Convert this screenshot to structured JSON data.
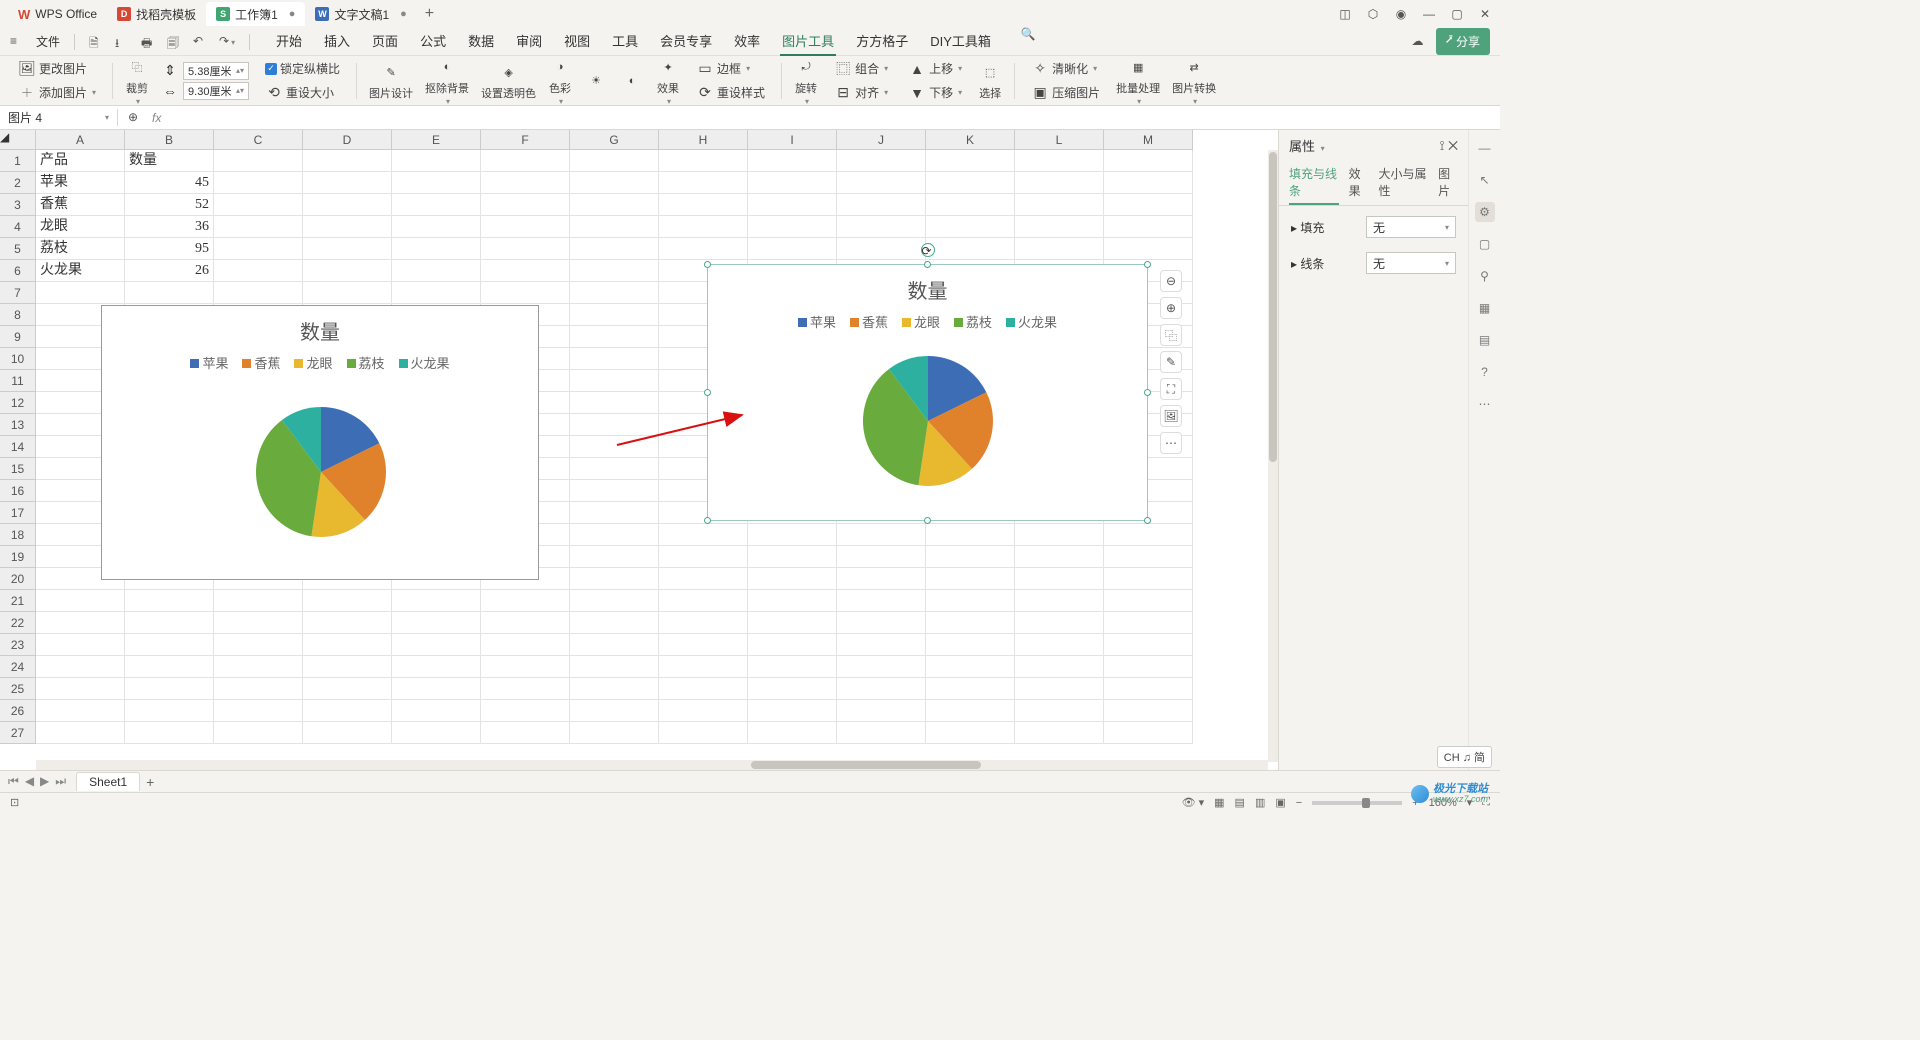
{
  "title_tabs": {
    "app_name": "WPS Office",
    "template_tab": "找稻壳模板",
    "workbook_tab": "工作簿1",
    "doc_tab": "文字文稿1"
  },
  "menu": {
    "file": "文件",
    "tabs": [
      "开始",
      "插入",
      "页面",
      "公式",
      "数据",
      "审阅",
      "视图",
      "工具",
      "会员专享",
      "效率",
      "图片工具",
      "方方格子",
      "DIY工具箱"
    ],
    "active": "图片工具",
    "share": "分享"
  },
  "ribbon": {
    "change_pic": "更改图片",
    "add_pic": "添加图片",
    "crop": "裁剪",
    "width_val": "5.38厘米",
    "height_val": "9.30厘米",
    "lock_ratio": "锁定纵横比",
    "reset_size": "重设大小",
    "pic_design": "图片设计",
    "remove_bg": "抠除背景",
    "set_trans": "设置透明色",
    "color": "色彩",
    "effect": "效果",
    "reset_style": "重设样式",
    "border": "边框",
    "rotate": "旋转",
    "group": "组合",
    "align": "对齐",
    "move_up": "上移",
    "move_down": "下移",
    "select": "选择",
    "sharpen": "清晰化",
    "compress": "压缩图片",
    "batch": "批量处理",
    "convert": "图片转换"
  },
  "name_box": "图片 4",
  "columns": [
    "A",
    "B",
    "C",
    "D",
    "E",
    "F",
    "G",
    "H",
    "I",
    "J",
    "K",
    "L",
    "M"
  ],
  "table": {
    "header_product": "产品",
    "header_qty": "数量",
    "rows": [
      {
        "product": "苹果",
        "qty": "45"
      },
      {
        "product": "香蕉",
        "qty": "52"
      },
      {
        "product": "龙眼",
        "qty": "36"
      },
      {
        "product": "荔枝",
        "qty": "95"
      },
      {
        "product": "火龙果",
        "qty": "26"
      }
    ]
  },
  "chart_data": {
    "type": "pie",
    "title": "数量",
    "series": [
      {
        "name": "苹果",
        "value": 45,
        "color": "#3d6eb5"
      },
      {
        "name": "香蕉",
        "value": 52,
        "color": "#e0822c"
      },
      {
        "name": "龙眼",
        "value": 36,
        "color": "#e8b82e"
      },
      {
        "name": "荔枝",
        "value": 95,
        "color": "#6aab3d"
      },
      {
        "name": "火龙果",
        "value": 26,
        "color": "#2eb0a0"
      }
    ]
  },
  "props": {
    "title": "属性",
    "tabs": [
      "填充与线条",
      "效果",
      "大小与属性",
      "图片"
    ],
    "fill_label": "填充",
    "line_label": "线条",
    "none_option": "无"
  },
  "sheet_tab": "Sheet1",
  "status": {
    "zoom": "160%",
    "ime": "CH ♫ 简"
  },
  "watermark": {
    "site": "极光下载站",
    "url": "www.xz7.com"
  }
}
